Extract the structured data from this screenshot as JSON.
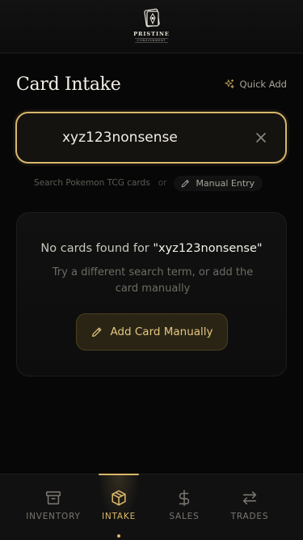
{
  "brand": {
    "name": "PRISTINE",
    "subtitle": "CONSIGNMENT"
  },
  "page": {
    "title": "Card Intake",
    "quick_add_label": "Quick Add"
  },
  "search": {
    "value": "xyz123nonsense",
    "placeholder": "Search Pokemon TCG cards"
  },
  "hint": {
    "text": "Search Pokemon TCG cards",
    "or_label": "or",
    "manual_entry_label": "Manual Entry"
  },
  "empty_state": {
    "title_prefix": "No cards found for ",
    "query_quoted": "\"xyz123nonsense\"",
    "subtitle": "Try a different search term, or add the card manually",
    "button_label": "Add Card Manually"
  },
  "nav": {
    "items": [
      {
        "label": "INVENTORY",
        "icon": "archive-box-icon",
        "active": false
      },
      {
        "label": "INTAKE",
        "icon": "package-icon",
        "active": true
      },
      {
        "label": "SALES",
        "icon": "dollar-icon",
        "active": false
      },
      {
        "label": "TRADES",
        "icon": "swap-arrows-icon",
        "active": false
      }
    ]
  },
  "colors": {
    "accent": "#d9b76a",
    "background": "#070707",
    "card": "#111111",
    "muted_text": "#6f6b64"
  }
}
